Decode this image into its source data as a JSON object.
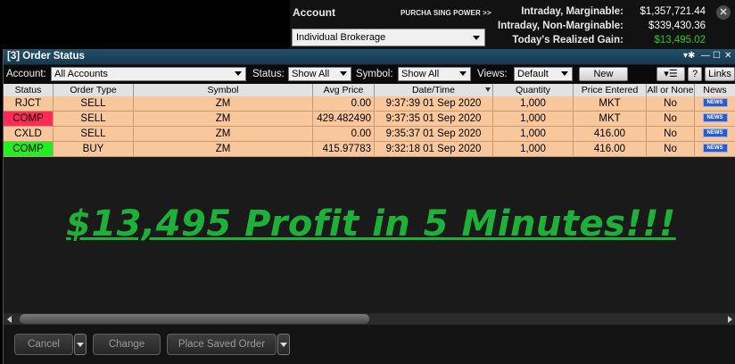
{
  "account_panel": {
    "label": "Account",
    "purchasing_power": "PURCHA SING POWER >>",
    "account_select": "Individual Brokerage",
    "metrics": [
      {
        "label": "Intraday, Marginable:",
        "value": "$1,357,721.44"
      },
      {
        "label": "Intraday, Non-Marginable:",
        "value": "$339,430.36"
      },
      {
        "label": "Today's Realized Gain:",
        "value": "$13,495.02"
      }
    ],
    "close_glyph": "✕"
  },
  "window": {
    "title": "[3] Order Status",
    "controls": [
      "▾✱",
      "—",
      "☐",
      "✕"
    ]
  },
  "filters": {
    "account_label": "Account:",
    "account_value": "All Accounts",
    "status_label": "Status:",
    "status_value": "Show All",
    "symbol_label": "Symbol:",
    "symbol_value": "Show All",
    "views_label": "Views:",
    "views_value": "Default",
    "new_label": "New",
    "menu_glyph": "▾☰",
    "help_label": "?",
    "links_label": "Links"
  },
  "table": {
    "columns": [
      "Status",
      "Order Type",
      "Symbol",
      "Avg Price",
      "Date/Time",
      "Quantity",
      "Price Entered",
      "All or None",
      "News"
    ],
    "rows": [
      {
        "status": "RJCT",
        "order_type": "SELL",
        "symbol": "ZM",
        "avg_price": "0.00",
        "datetime": "9:37:39 01 Sep 2020",
        "quantity": "1,000",
        "price_entered": "MKT",
        "all_or_none": "No",
        "news": "NEWS"
      },
      {
        "status": "COMP",
        "order_type": "SELL",
        "symbol": "ZM",
        "avg_price": "429.482490",
        "datetime": "9:37:35 01 Sep 2020",
        "quantity": "1,000",
        "price_entered": "MKT",
        "all_or_none": "No",
        "news": "NEWS"
      },
      {
        "status": "CXLD",
        "order_type": "SELL",
        "symbol": "ZM",
        "avg_price": "0.00",
        "datetime": "9:35:37 01 Sep 2020",
        "quantity": "1,000",
        "price_entered": "416.00",
        "all_or_none": "No",
        "news": "NEWS"
      },
      {
        "status": "COMP",
        "order_type": "BUY",
        "symbol": "ZM",
        "avg_price": "415.97783",
        "datetime": "9:32:18 01 Sep 2020",
        "quantity": "1,000",
        "price_entered": "416.00",
        "all_or_none": "No",
        "news": "NEWS"
      }
    ],
    "status_colors": {
      "row_default": "#f9c79c",
      "comp_sell": "#ff2a55",
      "comp_buy": "#22ee22"
    }
  },
  "overlay": {
    "headline": "$13,495 Profit in 5 Minutes!!!",
    "color": "#1db13a"
  },
  "bottom": {
    "cancel_label": "Cancel",
    "change_label": "Change",
    "place_saved_label": "Place Saved Order"
  }
}
